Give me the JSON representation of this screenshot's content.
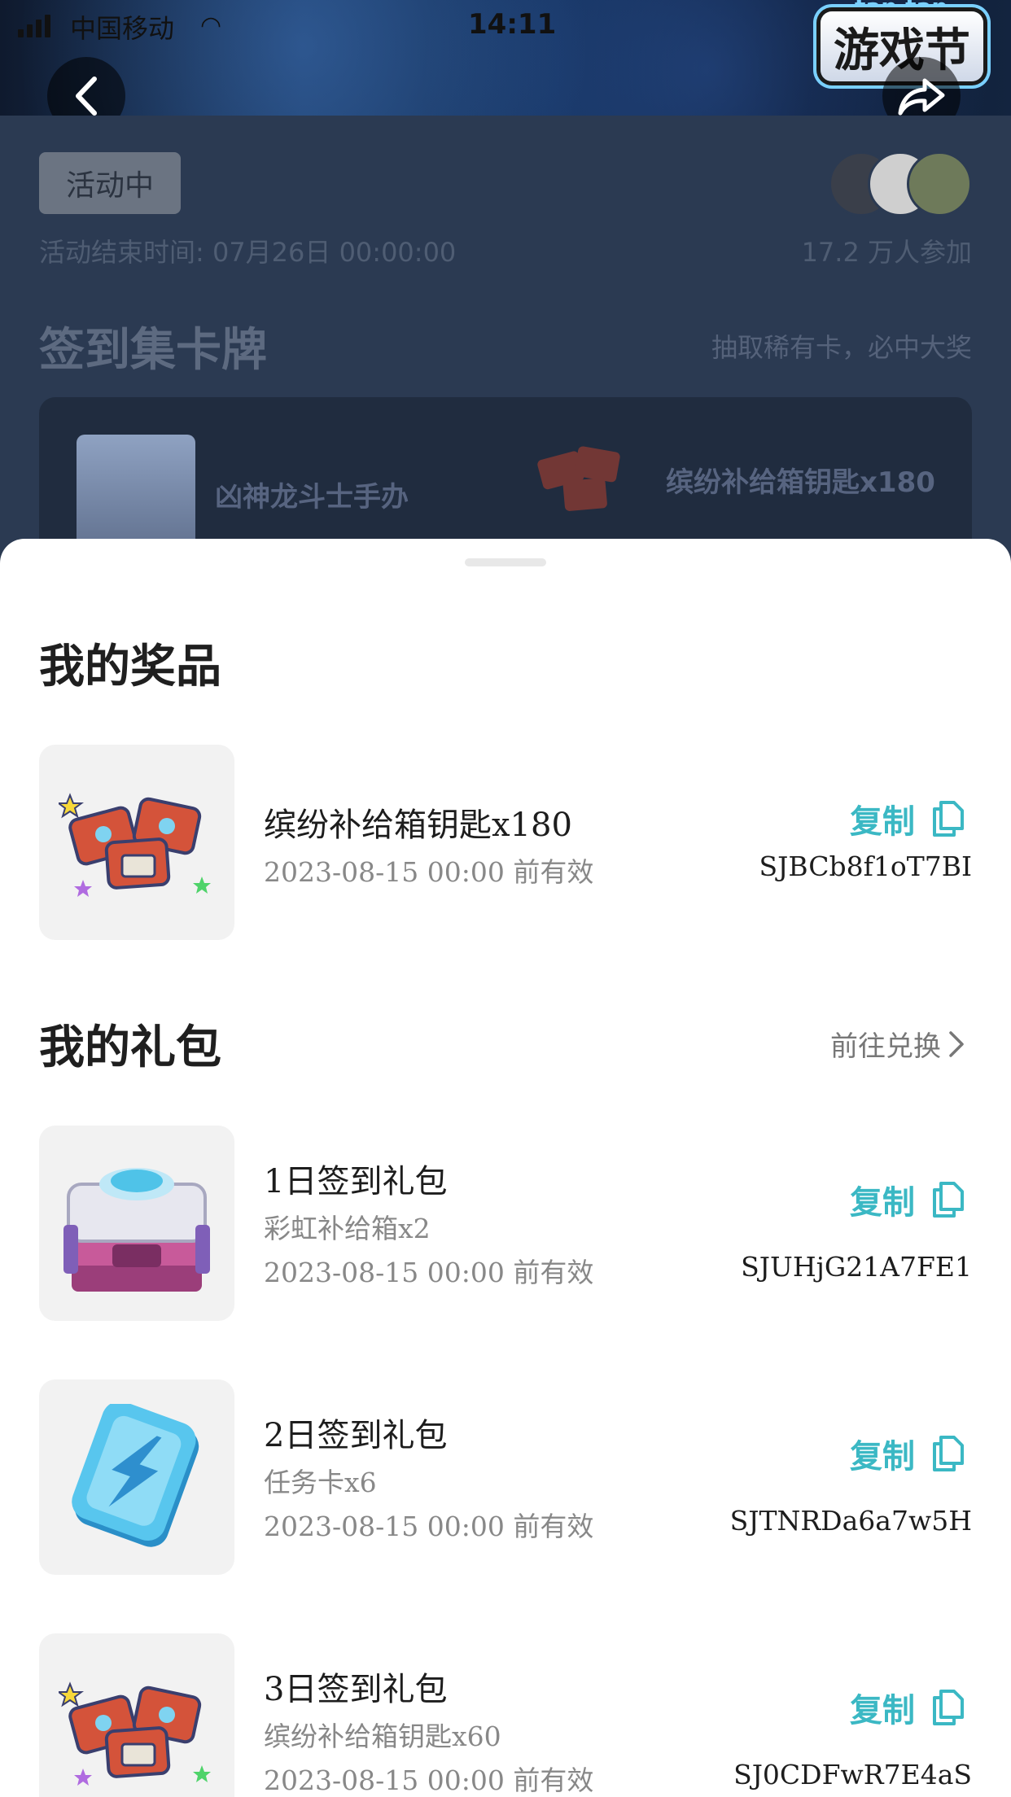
{
  "status_bar": {
    "carrier": "中国移动",
    "time": "14:11"
  },
  "banner": {
    "logo_top": "tap tap",
    "logo_text": "游戏节"
  },
  "activity": {
    "status": "活动中",
    "end_time": "活动结束时间: 07月26日 00:00:00",
    "participants": "17.2 万人参加",
    "section_title": "签到集卡牌",
    "section_hint": "抽取稀有卡，必中大奖",
    "cards": [
      {
        "label": "凶神龙斗士手办",
        "icon": "figure-icon"
      },
      {
        "label": "缤纷补给箱钥匙x180",
        "icon": "keys-icon"
      }
    ]
  },
  "prizes": {
    "title": "我的奖品",
    "items": [
      {
        "title": "缤纷补给箱钥匙x180",
        "date": "2023-08-15 00:00 前有效",
        "copy_label": "复制",
        "code": "SJBCb8f1oT7BI",
        "icon": "keys-icon"
      }
    ]
  },
  "gifts": {
    "title": "我的礼包",
    "link_label": "前往兑换",
    "items": [
      {
        "title": "1日签到礼包",
        "subtitle": "彩虹补给箱x2",
        "date": "2023-08-15 00:00 前有效",
        "copy_label": "复制",
        "code": "SJUHjG21A7FE1",
        "icon": "supply-box-icon"
      },
      {
        "title": "2日签到礼包",
        "subtitle": "任务卡x6",
        "date": "2023-08-15 00:00 前有效",
        "copy_label": "复制",
        "code": "SJTNRDa6a7w5H",
        "icon": "task-card-icon"
      },
      {
        "title": "3日签到礼包",
        "subtitle": "缤纷补给箱钥匙x60",
        "date": "2023-08-15 00:00 前有效",
        "copy_label": "复制",
        "code": "SJ0CDFwR7E4aS",
        "icon": "keys-icon"
      }
    ]
  },
  "colors": {
    "accent": "#3bb8c4",
    "sheet_bg": "#ffffff",
    "overlay": "#2b3a52"
  }
}
